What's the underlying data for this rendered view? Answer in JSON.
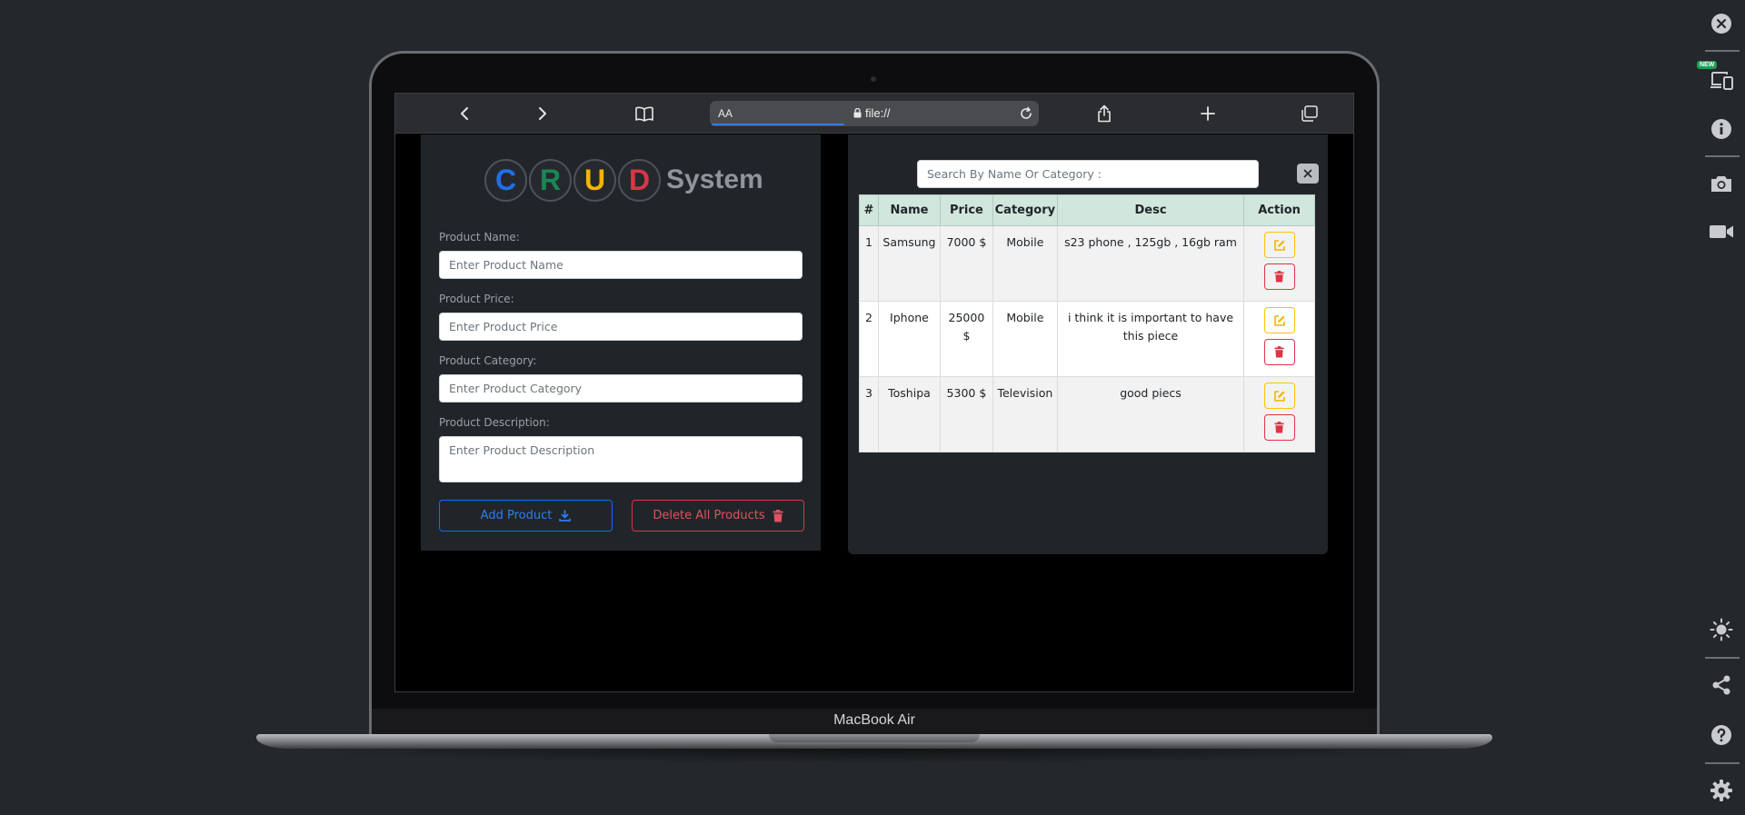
{
  "device": {
    "model_label": "MacBook Air"
  },
  "browser": {
    "text_size_label": "AA",
    "url": "file://"
  },
  "logo": {
    "letters": [
      {
        "char": "C",
        "color": "#1f6feb"
      },
      {
        "char": "R",
        "color": "#198754"
      },
      {
        "char": "U",
        "color": "#f4b400"
      },
      {
        "char": "D",
        "color": "#dc3545"
      }
    ],
    "word": "System"
  },
  "form": {
    "name": {
      "label": "Product Name:",
      "placeholder": "Enter Product Name"
    },
    "price": {
      "label": "Product Price:",
      "placeholder": "Enter Product Price"
    },
    "category": {
      "label": "Product Category:",
      "placeholder": "Enter Product Category"
    },
    "description": {
      "label": "Product Description:",
      "placeholder": "Enter Product Description"
    },
    "add_label": "Add Product",
    "delete_all_label": "Delete All Products"
  },
  "search": {
    "placeholder": "Search By Name Or Category :"
  },
  "table": {
    "headers": [
      "#",
      "Name",
      "Price",
      "Category",
      "Desc",
      "Action"
    ],
    "rows": [
      {
        "index": "1",
        "name": "Samsung",
        "price": "7000 $",
        "category": "Mobile",
        "desc": "s23 phone , 125gb , 16gb ram"
      },
      {
        "index": "2",
        "name": "Iphone",
        "price": "25000 $",
        "category": "Mobile",
        "desc": "i think it is important to have this piece"
      },
      {
        "index": "3",
        "name": "Toshipa",
        "price": "5300 $",
        "category": "Television",
        "desc": "good piecs"
      }
    ]
  },
  "sidebar": {
    "new_badge": "NEW"
  },
  "colors": {
    "accent_blue": "#0d6efd",
    "danger": "#dc3545",
    "warning": "#ffc107",
    "header_green": "#d1e7dd"
  }
}
